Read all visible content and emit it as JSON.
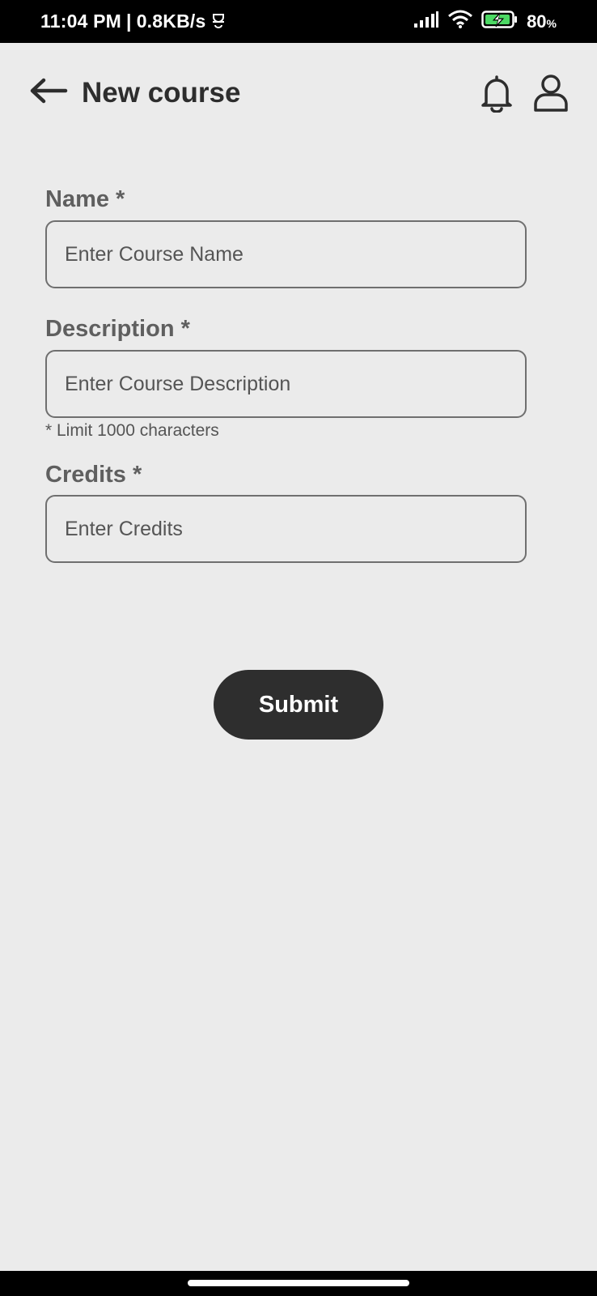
{
  "status_bar": {
    "time": "11:04 PM",
    "separator": "|",
    "network_speed": "0.8KB/s",
    "battery_percent": "80",
    "battery_unit": "%"
  },
  "header": {
    "title": "New course"
  },
  "form": {
    "name": {
      "label": "Name *",
      "placeholder": "Enter Course Name",
      "value": ""
    },
    "description": {
      "label": "Description *",
      "placeholder": "Enter Course Description",
      "value": "",
      "hint": "* Limit 1000 characters"
    },
    "credits": {
      "label": "Credits *",
      "placeholder": "Enter Credits",
      "value": ""
    },
    "submit_label": "Submit"
  },
  "icons": {
    "back": "arrow-left-icon",
    "notifications": "bell-icon",
    "profile": "user-icon"
  },
  "colors": {
    "background": "#ebebeb",
    "title": "#2d2d2d",
    "label": "#5f5f5f",
    "button": "#2e2e2e",
    "input_border": "#6f6f6f"
  }
}
